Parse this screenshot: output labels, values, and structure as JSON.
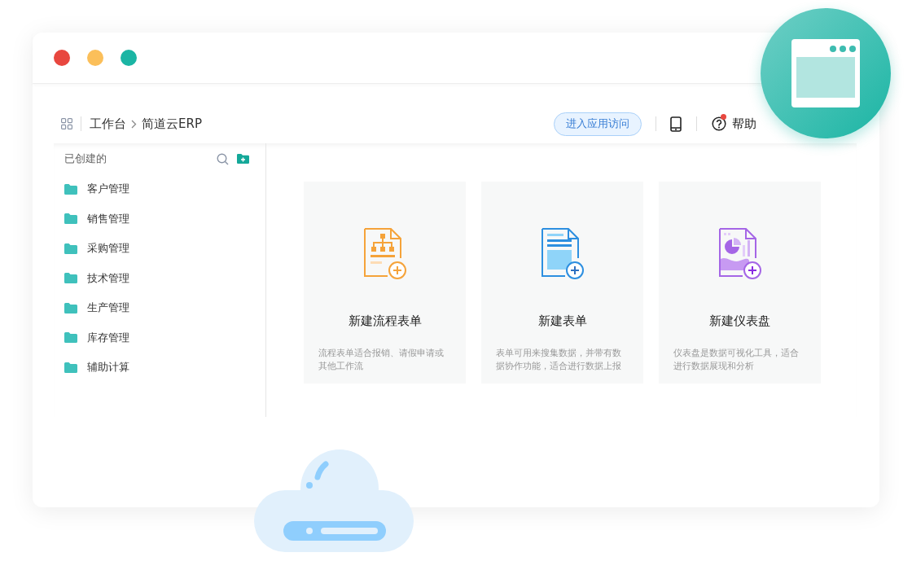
{
  "breadcrumb": [
    "工作台",
    "简道云ERP"
  ],
  "toolbar": {
    "visit_button": "进入应用访问",
    "help": {
      "label": "帮助",
      "notification": true
    }
  },
  "sidebar": {
    "title": "已创建的",
    "items": [
      "客户管理",
      "销售管理",
      "采购管理",
      "技术管理",
      "生产管理",
      "库存管理",
      "辅助计算"
    ]
  },
  "cards": [
    {
      "kind": "flow",
      "title": "新建流程表单",
      "description": "流程表单适合报销、请假申请或其他工作流"
    },
    {
      "kind": "form",
      "title": "新建表单",
      "description": "表单可用来搜集数据，并带有数据协作功能，适合进行数据上报"
    },
    {
      "kind": "dashboard",
      "title": "新建仪表盘",
      "description": "仪表盘是数据可视化工具，适合进行数据展现和分析"
    }
  ]
}
